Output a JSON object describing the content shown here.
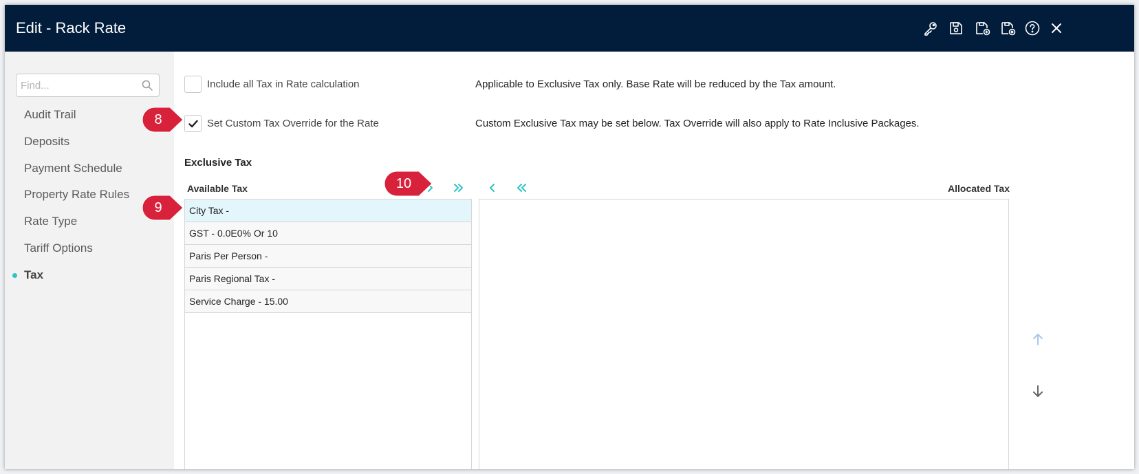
{
  "window": {
    "title": "Edit - Rack Rate",
    "header_icons": [
      "key-icon",
      "save-icon",
      "save-new-icon",
      "save-close-icon",
      "help-icon",
      "close-icon"
    ],
    "header_color": "#021c3b"
  },
  "sidebar": {
    "search_placeholder": "Find...",
    "items": [
      {
        "label": "Audit Trail"
      },
      {
        "label": "Deposits"
      },
      {
        "label": "Payment Schedule"
      },
      {
        "label": "Property Rate Rules"
      },
      {
        "label": "Rate Type"
      },
      {
        "label": "Tariff Options"
      },
      {
        "label": "Tax",
        "active": true
      }
    ],
    "accent_color": "#2ec4c6"
  },
  "options": [
    {
      "label": "Include all Tax in Rate calculation",
      "checked": false,
      "description": "Applicable to Exclusive Tax only. Base Rate will be reduced by the Tax amount."
    },
    {
      "label": "Set Custom Tax Override for the Rate",
      "checked": true,
      "description": "Custom Exclusive Tax may be set below. Tax Override will also apply to Rate Inclusive Packages."
    }
  ],
  "exclusive_tax": {
    "section_title": "Exclusive Tax",
    "available_label": "Available Tax",
    "allocated_label": "Allocated Tax",
    "available": [
      {
        "label": "City Tax -",
        "selected": true
      },
      {
        "label": "GST - 0.0E0% Or 10",
        "selected": false
      },
      {
        "label": "Paris Per Person -",
        "selected": false
      },
      {
        "label": "Paris Regional Tax -",
        "selected": false
      },
      {
        "label": "Service Charge - 15.00",
        "selected": false
      }
    ],
    "allocated": []
  },
  "callouts": {
    "c8": "8",
    "c9": "9",
    "c10": "10",
    "color": "#d8213a"
  }
}
